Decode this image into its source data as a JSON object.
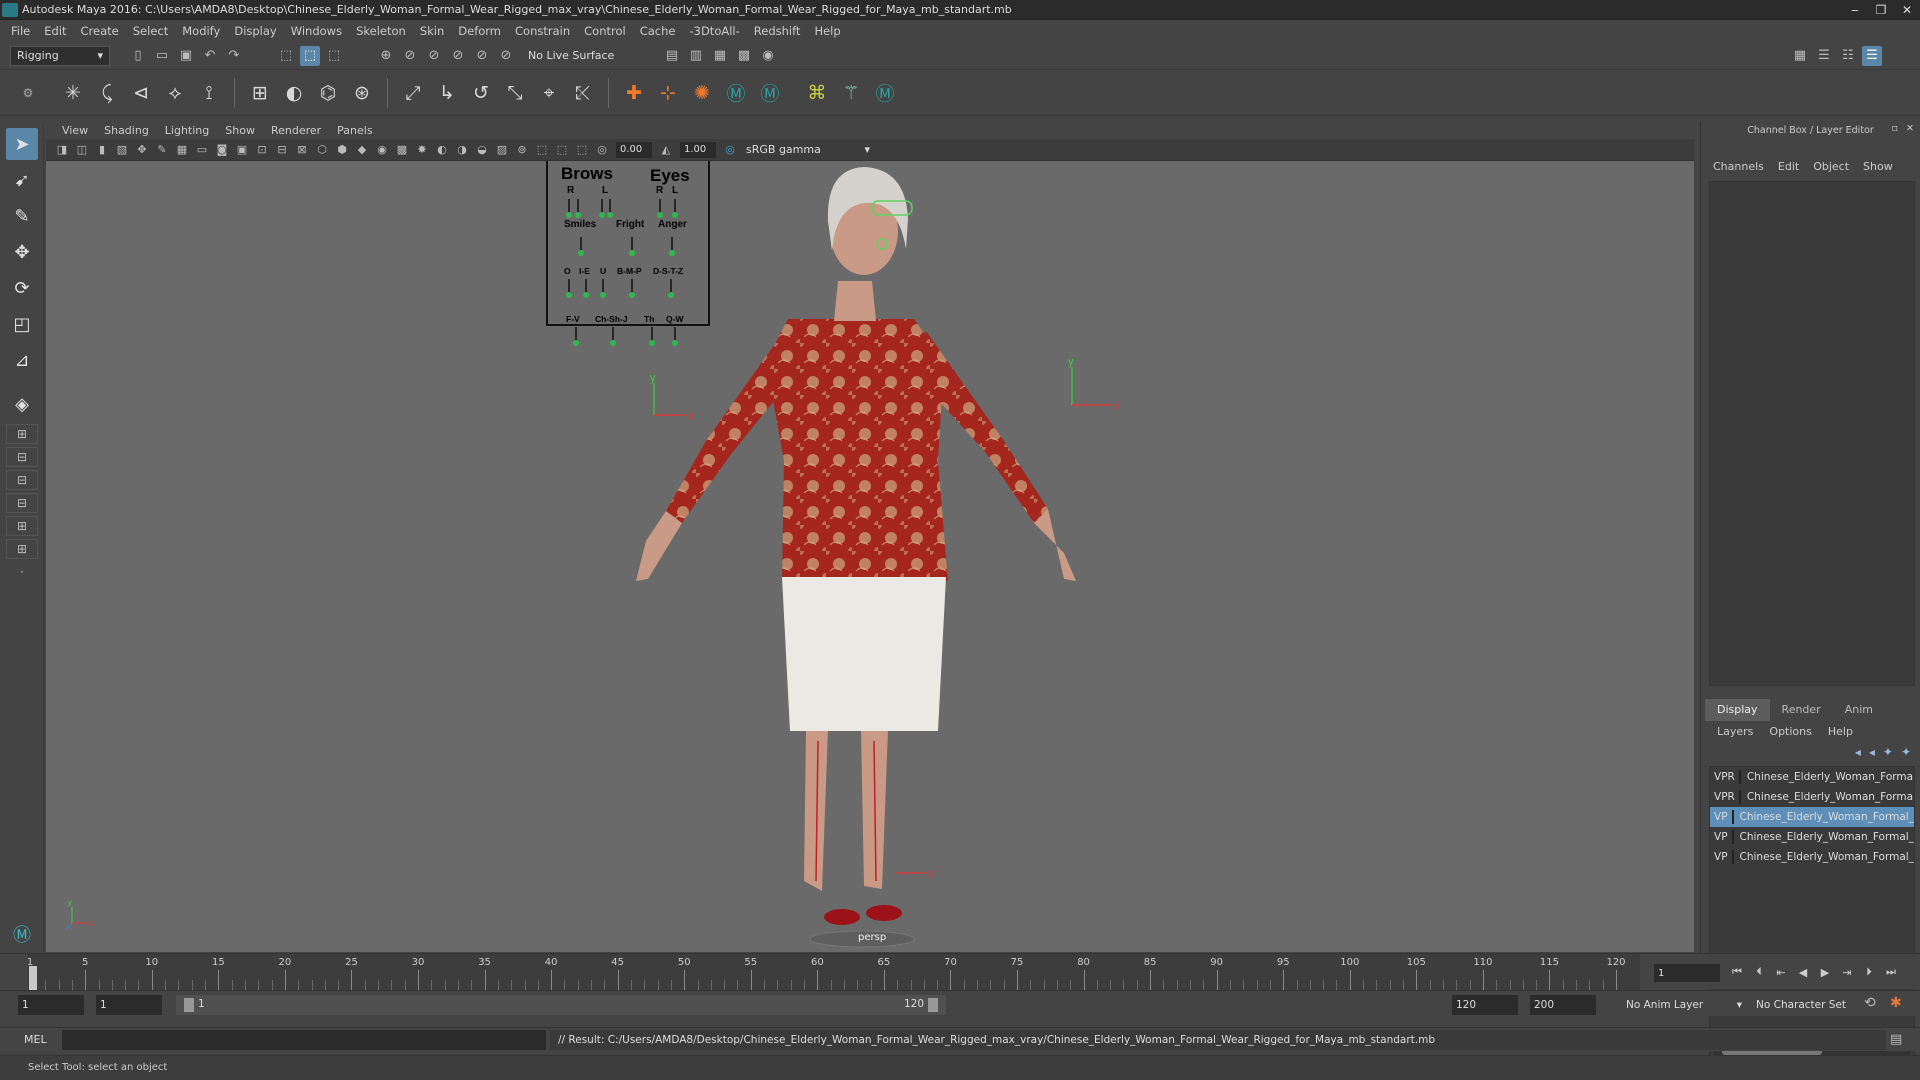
{
  "window": {
    "title": "Autodesk Maya 2016: C:\\Users\\AMDA8\\Desktop\\Chinese_Elderly_Woman_Formal_Wear_Rigged_max_vray\\Chinese_Elderly_Woman_Formal_Wear_Rigged_for_Maya_mb_standart.mb",
    "minimize": "‒",
    "maximize": "❐",
    "close": "✕"
  },
  "menubar": [
    "File",
    "Edit",
    "Create",
    "Select",
    "Modify",
    "Display",
    "Windows",
    "Skeleton",
    "Skin",
    "Deform",
    "Constrain",
    "Control",
    "Cache",
    "-3DtoAll-",
    "Redshift",
    "Help"
  ],
  "statusline": {
    "menuset": "Rigging",
    "live_surface": "No Live Surface"
  },
  "viewport_menu": [
    "View",
    "Shading",
    "Lighting",
    "Show",
    "Renderer",
    "Panels"
  ],
  "viewport_toolbar": {
    "exposure": "0.00",
    "gamma": "1.00",
    "colorspace": "sRGB gamma"
  },
  "viewport": {
    "camera": "persp",
    "face_controls": {
      "brows": "Brows",
      "eyes": "Eyes",
      "r": "R",
      "l": "L",
      "smiles": "Smiles",
      "fright": "Fright",
      "anger": "Anger",
      "phonemes1": [
        "O",
        "I-E",
        "U",
        "B-M-P",
        "D-S-T-Z"
      ],
      "phonemes2": [
        "F-V",
        "Ch-Sh-J",
        "Th",
        "Q-W"
      ]
    }
  },
  "channel_box": {
    "title": "Channel Box / Layer Editor",
    "menu": [
      "Channels",
      "Edit",
      "Object",
      "Show"
    ]
  },
  "layer_editor": {
    "tabs": [
      "Display",
      "Render",
      "Anim"
    ],
    "active_tab": "Display",
    "menu": [
      "Layers",
      "Options",
      "Help"
    ],
    "layers": [
      {
        "v": "V",
        "p": "P",
        "r": "R",
        "color": "#1f5f2a",
        "name": "Chinese_Elderly_Woman_Formal_Wear_Rigged",
        "selected": false
      },
      {
        "v": "V",
        "p": "P",
        "r": "R",
        "color": "#e0a878",
        "name": "Chinese_Elderly_Woman_Formal_Wear_Rigged",
        "selected": false
      },
      {
        "v": "V",
        "p": "P",
        "r": "",
        "color": "#6fb83c",
        "name": "Chinese_Elderly_Woman_Formal_Wear_Rigged",
        "selected": true
      },
      {
        "v": "V",
        "p": "P",
        "r": "",
        "color": "#101070",
        "name": "Chinese_Elderly_Woman_Formal_Wear_Rigged",
        "selected": false
      },
      {
        "v": "V",
        "p": "P",
        "r": "",
        "color": "#b01030",
        "name": "Chinese_Elderly_Woman_Formal_Wear_Rigged",
        "selected": false
      }
    ]
  },
  "timeline": {
    "start": 1,
    "end": 120,
    "labels": [
      "5",
      "10",
      "15",
      "20",
      "25",
      "30",
      "35",
      "40",
      "45",
      "50",
      "55",
      "60",
      "65",
      "70",
      "75",
      "80",
      "85",
      "90",
      "95",
      "100",
      "105",
      "110",
      "115",
      "120"
    ],
    "current_frame": "1",
    "first_label": "1"
  },
  "range": {
    "start": "1",
    "playback_start": "1",
    "slider_start": "1",
    "slider_end": "120",
    "playback_end": "120",
    "end": "200",
    "anim_layer": "No Anim Layer",
    "character_set": "No Character Set"
  },
  "command": {
    "lang": "MEL",
    "result": "// Result: C:/Users/AMDA8/Desktop/Chinese_Elderly_Woman_Formal_Wear_Rigged_max_vray/Chinese_Elderly_Woman_Formal_Wear_Rigged_for_Maya_mb_standart.mb"
  },
  "helpline": "Select Tool: select an object"
}
